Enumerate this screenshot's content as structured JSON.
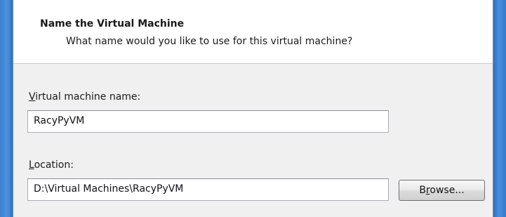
{
  "wizard": {
    "title": "Name the Virtual Machine",
    "subtitle": "What name would you like to use for this virtual machine?"
  },
  "vm_name": {
    "label_mnemonic": "V",
    "label_rest": "irtual machine name:",
    "value": "RacyPyVM"
  },
  "location": {
    "label_mnemonic": "L",
    "label_rest": "ocation:",
    "value": "D:\\Virtual Machines\\RacyPyVM",
    "browse_prefix": "B",
    "browse_mnemonic": "r",
    "browse_rest": "owse..."
  },
  "colors": {
    "frame_blue": "#2c6cbd",
    "dialog_bg": "#f0f0f0",
    "header_bg": "#ffffff"
  }
}
